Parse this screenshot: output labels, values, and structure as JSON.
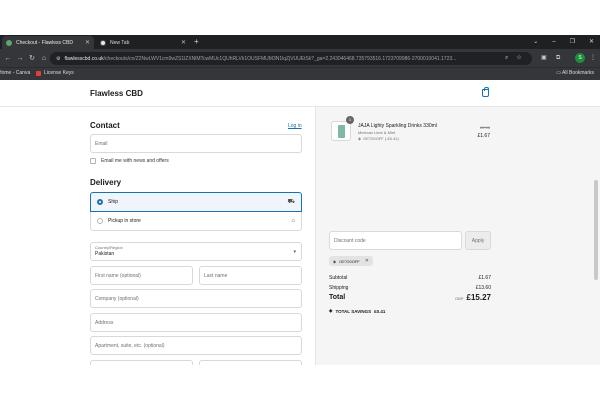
{
  "browser": {
    "tabs": [
      {
        "label": "Checkout - Flawless CBD",
        "active": true
      },
      {
        "label": "New Tab",
        "active": false
      }
    ],
    "new_tab_glyph": "+",
    "window_buttons": [
      "⌄",
      "–",
      "❐",
      "✕"
    ],
    "address": {
      "host": "flawlesscbd.co.uk",
      "path": "/checkouts/cn/Z2NwLWV1cm9wZS1lZXNlMTcwMUc1QUhRLVk1OUSFMUM3N1lqZjVUUEtSk?_ga=2.243046468.735793516.1723709986-2700010041.1723..."
    },
    "profile_initial": "S",
    "bookmarks": [
      {
        "label": "Home - Canva",
        "color": "#00c4cc"
      },
      {
        "label": "License Keys",
        "color": "#e04040"
      }
    ],
    "all_bookmarks": "All Bookmarks"
  },
  "store": {
    "name": "Flawless CBD",
    "cart_icon": "shopping-bag-icon"
  },
  "contact": {
    "heading": "Contact",
    "login_link": "Log in",
    "email_placeholder": "Email",
    "newsletter_label": "Email me with news and offers"
  },
  "delivery": {
    "heading": "Delivery",
    "options": [
      {
        "label": "Ship",
        "selected": true,
        "icon": "truck-icon"
      },
      {
        "label": "Pickup in store",
        "selected": false,
        "icon": "store-icon"
      }
    ],
    "country_label": "Country/Region",
    "country_value": "Pakistan",
    "first_name_placeholder": "First name (optional)",
    "last_name_placeholder": "Last name",
    "company_placeholder": "Company (optional)",
    "address_placeholder": "Address",
    "apartment_placeholder": "Apartment, suite, etc. (optional)"
  },
  "order": {
    "product": {
      "quantity": "1",
      "name": "JAJA Lighty Sparkling Drinks 330ml",
      "variant": "Mexican Lime & Mint",
      "discount_code": "GET20OFF (-£0.41)",
      "original_price": "£2.08",
      "price": "£1.67"
    },
    "discount_placeholder": "Discount code",
    "apply_label": "Apply",
    "applied_code": "GET20OFF",
    "subtotal_label": "Subtotal",
    "subtotal_value": "£1.67",
    "shipping_label": "Shipping",
    "shipping_value": "£13.60",
    "total_label": "Total",
    "currency": "GBP",
    "total_value": "£15.27",
    "savings_label": "TOTAL SAVINGS",
    "savings_value": "£0.41"
  }
}
